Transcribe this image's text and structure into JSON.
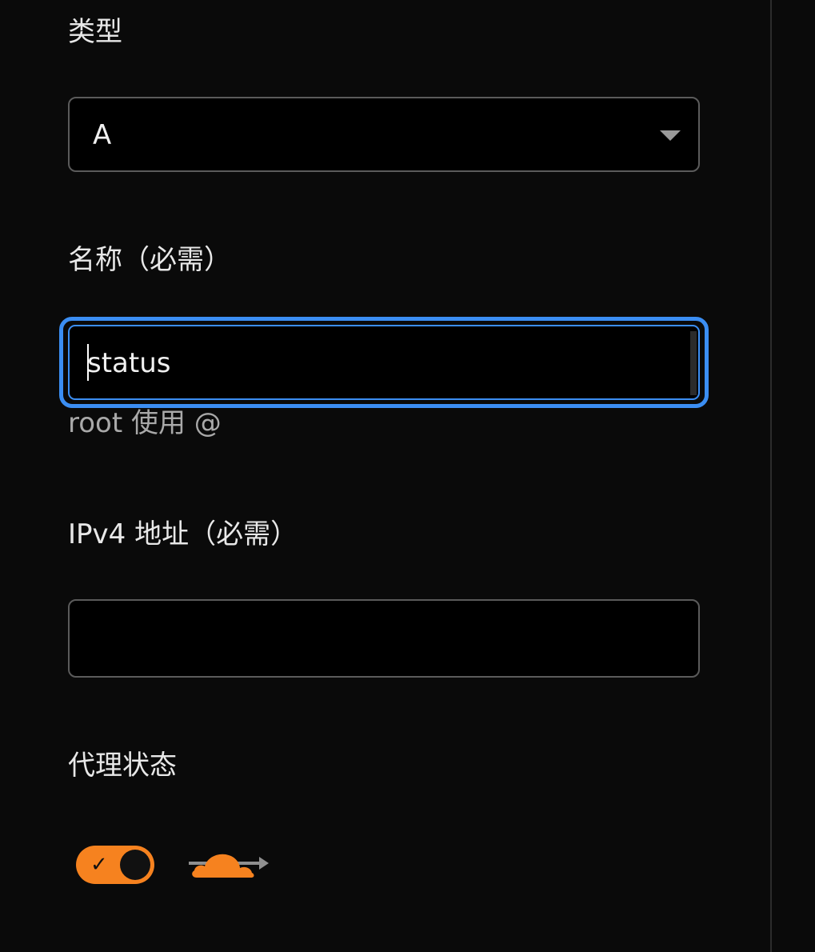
{
  "form": {
    "type": {
      "label": "类型",
      "value": "A"
    },
    "name": {
      "label": "名称（必需）",
      "value": "status",
      "hint": "root 使用 @"
    },
    "ipv4": {
      "label": "IPv4 地址（必需）",
      "value": ""
    },
    "proxy": {
      "label": "代理状态",
      "enabled": true,
      "icon": "proxied-cloud-icon"
    }
  },
  "colors": {
    "accent": "#f6821f",
    "focus": "#3b8ef3",
    "background": "#0a0a0a",
    "field_bg": "#000000",
    "field_border": "#5b5b5b"
  }
}
